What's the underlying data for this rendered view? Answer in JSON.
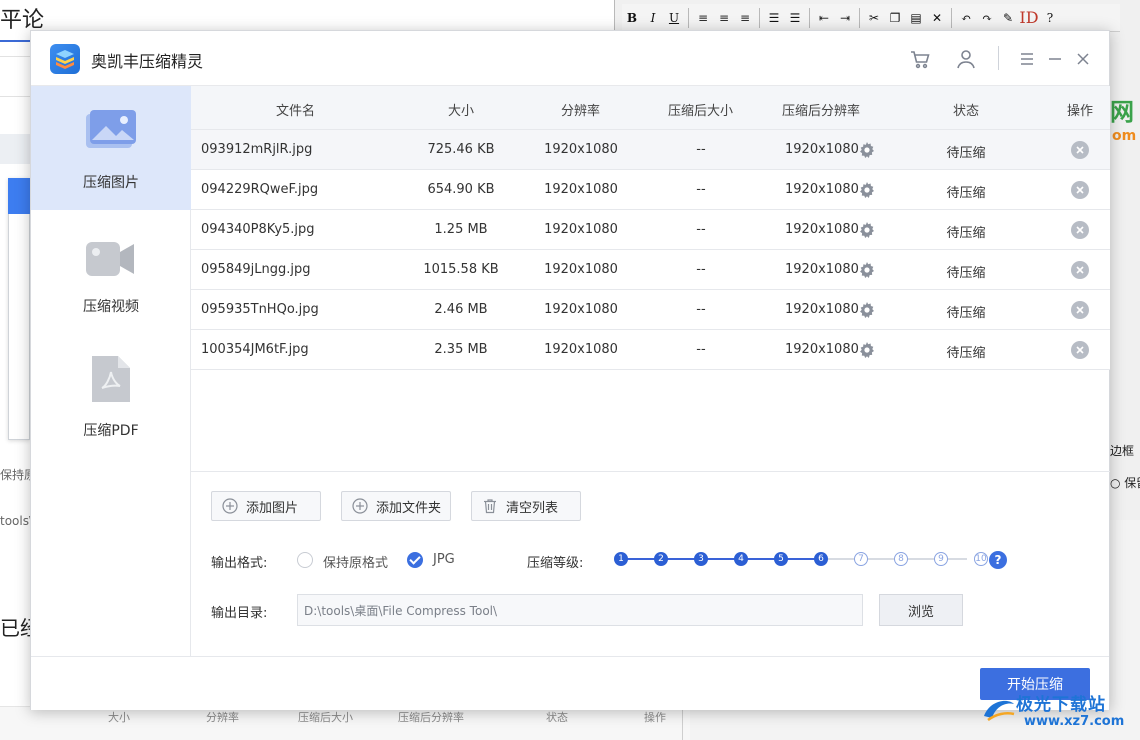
{
  "background": {
    "left_title": "平论",
    "left_label_keep": "保持原",
    "left_label_path": "tools\\桌",
    "left_big_text": "已经",
    "bottom_headers": [
      "大小",
      "分辨率",
      "压缩后大小",
      "压缩后分辨率",
      "状态",
      "操作"
    ],
    "right_label_border": "边框",
    "right_label_keep": "保留",
    "right_logo_text": "网",
    "right_logo_sub": "om"
  },
  "watermark": {
    "name": "极光下载站",
    "url": "www.xz7.com"
  },
  "app": {
    "title": "奥凯丰压缩精灵",
    "icons": [
      "cart-icon",
      "user-icon",
      "menu-icon",
      "minimize-icon",
      "close-icon"
    ]
  },
  "sidebar": {
    "items": [
      {
        "label": "压缩图片",
        "icon": "image-icon",
        "active": true
      },
      {
        "label": "压缩视频",
        "icon": "video-camera-icon",
        "active": false
      },
      {
        "label": "压缩PDF",
        "icon": "pdf-file-icon",
        "active": false
      }
    ]
  },
  "table": {
    "headers": [
      "文件名",
      "大小",
      "分辨率",
      "压缩后大小",
      "压缩后分辨率",
      "状态",
      "操作"
    ],
    "rows": [
      {
        "name": "093912mRjlR.jpg",
        "size": "725.46 KB",
        "res": "1920x1080",
        "csize": "--",
        "cres": "1920x1080",
        "status": "待压缩"
      },
      {
        "name": "094229RQweF.jpg",
        "size": "654.90 KB",
        "res": "1920x1080",
        "csize": "--",
        "cres": "1920x1080",
        "status": "待压缩"
      },
      {
        "name": "094340P8Ky5.jpg",
        "size": "1.25 MB",
        "res": "1920x1080",
        "csize": "--",
        "cres": "1920x1080",
        "status": "待压缩"
      },
      {
        "name": "095849jLngg.jpg",
        "size": "1015.58 KB",
        "res": "1920x1080",
        "csize": "--",
        "cres": "1920x1080",
        "status": "待压缩"
      },
      {
        "name": "095935TnHQo.jpg",
        "size": "2.46 MB",
        "res": "1920x1080",
        "csize": "--",
        "cres": "1920x1080",
        "status": "待压缩"
      },
      {
        "name": "100354JM6tF.jpg",
        "size": "2.35 MB",
        "res": "1920x1080",
        "csize": "--",
        "cres": "1920x1080",
        "status": "待压缩"
      }
    ]
  },
  "actions": {
    "add_image": "添加图片",
    "add_folder": "添加文件夹",
    "clear_list": "清空列表"
  },
  "output": {
    "format_label": "输出格式:",
    "format_options": [
      {
        "label": "保持原格式",
        "checked": false
      },
      {
        "label": "JPG",
        "checked": true
      }
    ],
    "level_label": "压缩等级:",
    "levels": [
      "1",
      "2",
      "3",
      "4",
      "5",
      "6",
      "7",
      "8",
      "9",
      "10"
    ],
    "level_value": 6,
    "help": "?",
    "dir_label": "输出目录:",
    "dir_value": "D:\\tools\\桌面\\File Compress Tool\\",
    "browse": "浏览"
  },
  "footer": {
    "start": "开始压缩"
  },
  "colors": {
    "accent": "#3c6fe0",
    "sidebar_active": "#dde7fa",
    "header_bg": "#f4f6f9"
  }
}
